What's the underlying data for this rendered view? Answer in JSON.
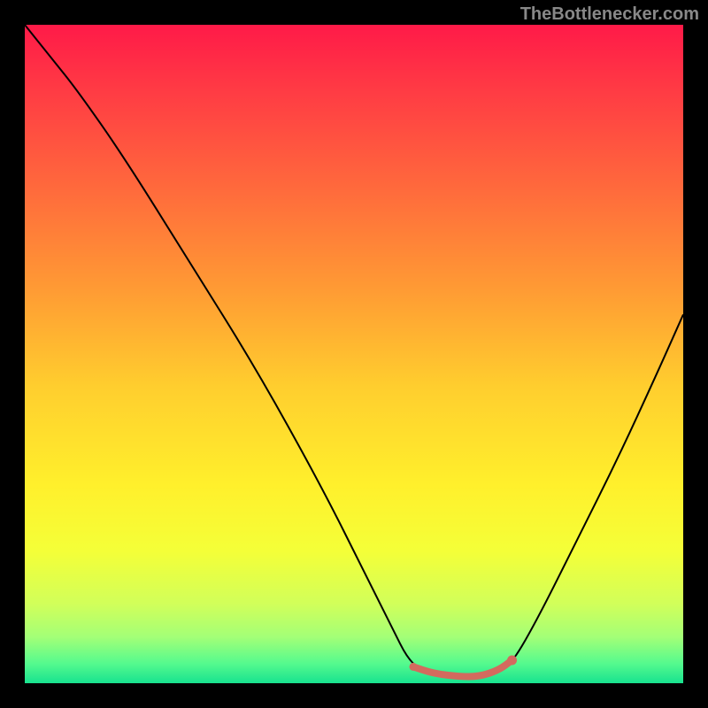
{
  "watermark": "TheBottlenecker.com",
  "chart_data": {
    "type": "line",
    "title": "",
    "xlabel": "",
    "ylabel": "",
    "xlim": [
      0,
      100
    ],
    "ylim": [
      0,
      100
    ],
    "background": {
      "type": "vertical-gradient",
      "stops": [
        {
          "offset": 0.0,
          "color": "#ff1a48"
        },
        {
          "offset": 0.1,
          "color": "#ff3b44"
        },
        {
          "offset": 0.25,
          "color": "#ff6a3c"
        },
        {
          "offset": 0.4,
          "color": "#ff9a34"
        },
        {
          "offset": 0.55,
          "color": "#ffce2e"
        },
        {
          "offset": 0.7,
          "color": "#fff02c"
        },
        {
          "offset": 0.8,
          "color": "#f4ff38"
        },
        {
          "offset": 0.88,
          "color": "#d1ff5a"
        },
        {
          "offset": 0.93,
          "color": "#a3ff77"
        },
        {
          "offset": 0.97,
          "color": "#55fa8e"
        },
        {
          "offset": 1.0,
          "color": "#18e28f"
        }
      ]
    },
    "series": [
      {
        "name": "main-curve",
        "stroke": "#000000",
        "stroke_width": 2,
        "points": [
          {
            "x": 0,
            "y": 100
          },
          {
            "x": 4,
            "y": 95
          },
          {
            "x": 8,
            "y": 90
          },
          {
            "x": 15,
            "y": 80
          },
          {
            "x": 25,
            "y": 64
          },
          {
            "x": 35,
            "y": 48
          },
          {
            "x": 45,
            "y": 30
          },
          {
            "x": 52,
            "y": 16
          },
          {
            "x": 56,
            "y": 8
          },
          {
            "x": 58,
            "y": 4
          },
          {
            "x": 60,
            "y": 2
          },
          {
            "x": 63,
            "y": 1
          },
          {
            "x": 66,
            "y": 1
          },
          {
            "x": 69,
            "y": 1
          },
          {
            "x": 72,
            "y": 2
          },
          {
            "x": 74,
            "y": 3
          },
          {
            "x": 78,
            "y": 10
          },
          {
            "x": 84,
            "y": 22
          },
          {
            "x": 90,
            "y": 34
          },
          {
            "x": 96,
            "y": 47
          },
          {
            "x": 100,
            "y": 56
          }
        ]
      },
      {
        "name": "highlight-segment",
        "stroke": "#d36a5e",
        "stroke_width": 8,
        "points": [
          {
            "x": 59,
            "y": 2.5
          },
          {
            "x": 62,
            "y": 1.5
          },
          {
            "x": 66,
            "y": 1
          },
          {
            "x": 69,
            "y": 1
          },
          {
            "x": 72,
            "y": 2
          },
          {
            "x": 74,
            "y": 3.5
          }
        ]
      }
    ],
    "markers": [
      {
        "x": 59,
        "y": 2.5,
        "r": 4.5,
        "color": "#d36a5e",
        "name": "highlight-start"
      },
      {
        "x": 74,
        "y": 3.5,
        "r": 5.5,
        "color": "#d36a5e",
        "name": "highlight-end"
      }
    ]
  }
}
